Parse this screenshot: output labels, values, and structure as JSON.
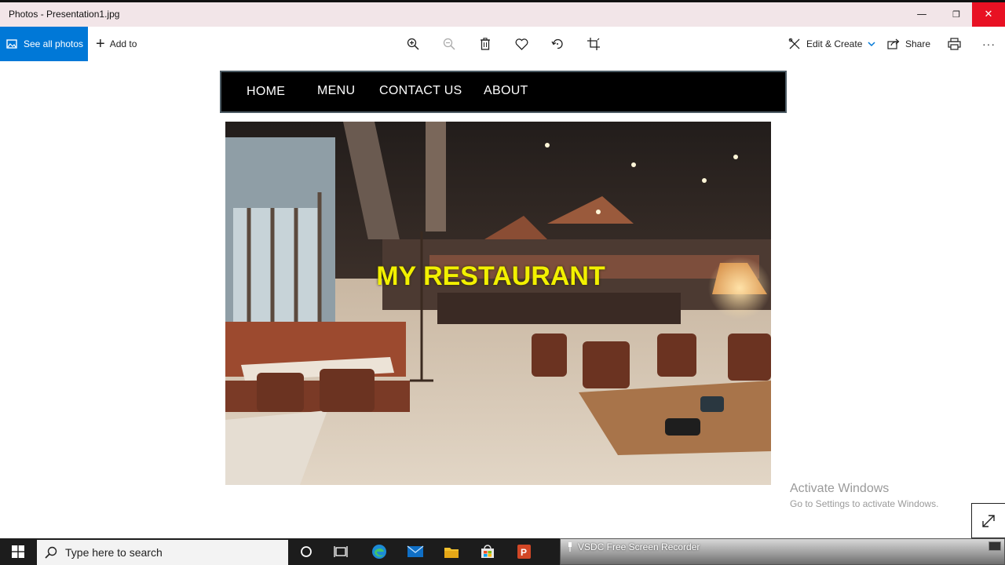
{
  "window": {
    "title": "Photos - Presentation1.jpg",
    "minimize": "—",
    "restore": "❐",
    "close": "✕"
  },
  "toolbar": {
    "see_all_photos": "See all photos",
    "add_to": "Add to",
    "edit_create": "Edit & Create",
    "share": "Share",
    "more": "···",
    "icons": [
      "zoom-in-icon",
      "zoom-out-icon",
      "delete-icon",
      "heart-icon",
      "rotate-icon",
      "crop-icon",
      "print-icon"
    ]
  },
  "image": {
    "nav": [
      "HOME",
      "MENU",
      "CONTACT US",
      "ABOUT"
    ],
    "headline": "MY RESTAURANT"
  },
  "watermark": {
    "line1": "Activate Windows",
    "line2": "Go to Settings to activate Windows."
  },
  "taskbar": {
    "search_placeholder": "Type here to search",
    "apps": [
      "cortana-icon",
      "task-view-icon",
      "edge-icon",
      "mail-icon",
      "file-explorer-icon",
      "store-icon",
      "powerpoint-icon"
    ]
  },
  "recorder": {
    "title": "VSDC Free Screen Recorder"
  },
  "colors": {
    "accent": "#0078d7",
    "close": "#e81123",
    "headline": "#f2f000",
    "navbar": "#000000"
  }
}
